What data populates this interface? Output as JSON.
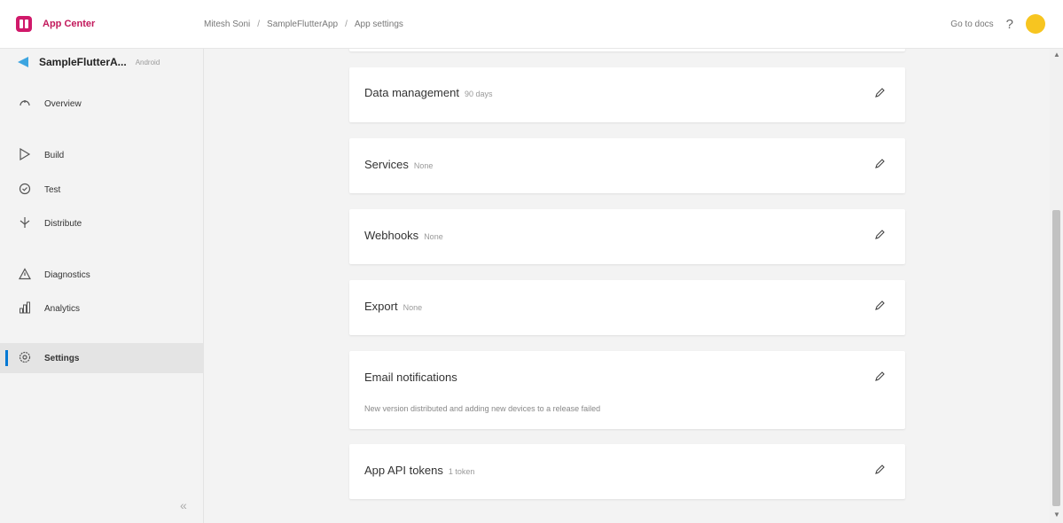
{
  "header": {
    "brand": "App Center",
    "breadcrumb": [
      "Mitesh Soni",
      "SampleFlutterApp",
      "App settings"
    ],
    "breadcrumb_separator": "/",
    "docs_link": "Go to docs",
    "help": "?"
  },
  "sidebar": {
    "app_name": "SampleFlutterA...",
    "platform": "Android",
    "items": [
      {
        "label": "Overview",
        "icon": "gauge-icon"
      },
      {
        "label": "Build",
        "icon": "play-icon"
      },
      {
        "label": "Test",
        "icon": "check-circle-icon"
      },
      {
        "label": "Distribute",
        "icon": "distribute-icon"
      },
      {
        "label": "Diagnostics",
        "icon": "warning-icon"
      },
      {
        "label": "Analytics",
        "icon": "bar-chart-icon"
      },
      {
        "label": "Settings",
        "icon": "gear-icon",
        "active": true
      }
    ],
    "collapse": "«"
  },
  "settings": [
    {
      "title": "Data management",
      "value": "90 days"
    },
    {
      "title": "Services",
      "value": "None"
    },
    {
      "title": "Webhooks",
      "value": "None"
    },
    {
      "title": "Export",
      "value": "None"
    },
    {
      "title": "Email notifications",
      "value": "",
      "description": "New version distributed and adding new devices to a release failed"
    },
    {
      "title": "App API tokens",
      "value": "1 token"
    }
  ],
  "colors": {
    "brand": "#c2185b",
    "accent": "#0078d4",
    "avatar": "#f7c520"
  }
}
